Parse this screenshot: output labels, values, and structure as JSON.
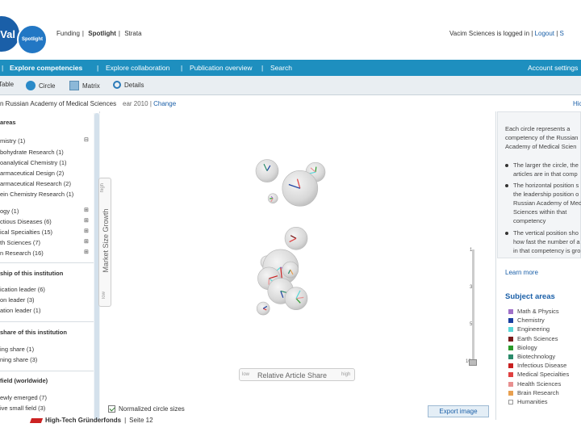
{
  "header": {
    "logo_text": "Val",
    "spotlight_label": "Spotlight",
    "product_nav": [
      "Funding",
      "Spotlight",
      "Strata"
    ],
    "user_text": "Vacim Sciences is logged in",
    "logout_label": "Logout",
    "extra_link": "S"
  },
  "main_nav": {
    "items": [
      "Explore competencies",
      "Explore collaboration",
      "Publication overview",
      "Search"
    ],
    "right_link": "Account settings"
  },
  "view_bar": {
    "items": [
      "Table",
      "Circle",
      "Matrix",
      "Details"
    ]
  },
  "context": {
    "institution": "n Russian Academy of Medical Sciences",
    "year_text": "ear 2010",
    "change_label": "Change",
    "right_label": "Hic"
  },
  "left_panel": {
    "areas_title": "areas",
    "areas_items": [
      "mistry (1)",
      "bohydrate Research (1)",
      "oanalytical Chemistry (1)",
      "armaceutical Design (2)",
      "armaceutical Research (2)",
      "ein Chemistry Research (1)"
    ],
    "areas_items2": [
      "ogy (1)",
      "ctious Diseases (6)",
      "ical Specialties (15)",
      "th Sciences (7)",
      "n Research (16)"
    ],
    "leadership_title": "ship of this institution",
    "leadership_items": [
      "ication leader (6)",
      "on leader (3)",
      "ation leader (1)"
    ],
    "share_title": "share of this institution",
    "share_items": [
      "ing share (1)",
      "ning share (3)"
    ],
    "field_title": "field (worldwide)",
    "field_items": [
      "ewly emerged (7)",
      "ive small field (3)"
    ]
  },
  "chart_axes": {
    "y_label": "Market Size Growth",
    "y_high": "high",
    "y_low": "low",
    "x_label": "Relative Article Share",
    "x_low": "low",
    "x_high": "high",
    "slider_ticks": [
      "1",
      "3",
      "5",
      "10"
    ]
  },
  "chart_data": {
    "type": "scatter",
    "note": "Bubble positions estimated on a 0-100 relative scale",
    "points": [
      {
        "x": 5,
        "y": 88,
        "size": 14
      },
      {
        "x": 30,
        "y": 87,
        "size": 12
      },
      {
        "x": 22,
        "y": 74,
        "size": 22
      },
      {
        "x": 8,
        "y": 66,
        "size": 6
      },
      {
        "x": 20,
        "y": 34,
        "size": 14
      },
      {
        "x": 5,
        "y": 15,
        "size": 8
      },
      {
        "x": 10,
        "y": 16,
        "size": 10
      },
      {
        "x": 12,
        "y": 11,
        "size": 22
      },
      {
        "x": 17,
        "y": 9,
        "size": 10
      },
      {
        "x": 6,
        "y": 2,
        "size": 14
      },
      {
        "x": 12,
        "y": -8,
        "size": 16
      },
      {
        "x": 20,
        "y": -14,
        "size": 14
      },
      {
        "x": 3,
        "y": -22,
        "size": 8
      }
    ]
  },
  "controls": {
    "normalized_label": "Normalized circle sizes",
    "export_label": "Export image"
  },
  "right_panel": {
    "intro_lines": [
      "Each circle represents a",
      "competency of the Russian",
      "Academy of Medical Scien"
    ],
    "bullet1": [
      "The larger the circle, the",
      "articles are in that comp"
    ],
    "bullet2": [
      "The horizontal position s",
      "the leadership position o",
      "Russian Academy of Med",
      "Sciences within that",
      "competency"
    ],
    "bullet3": [
      "The vertical position sho",
      "how fast the number of a",
      "in that competency is gro"
    ],
    "learn_more": "Learn more",
    "subject_title": "Subject areas",
    "subjects": [
      {
        "label": "Math & Physics",
        "color": "#a070c8"
      },
      {
        "label": "Chemistry",
        "color": "#1a3fa0"
      },
      {
        "label": "Engineering",
        "color": "#5ad8d8"
      },
      {
        "label": "Earth Sciences",
        "color": "#7a1a1a"
      },
      {
        "label": "Biology",
        "color": "#2a9a2a"
      },
      {
        "label": "Biotechnology",
        "color": "#2a8a6a"
      },
      {
        "label": "Infectious Disease",
        "color": "#c82020"
      },
      {
        "label": "Medical Specialties",
        "color": "#e04040"
      },
      {
        "label": "Health Sciences",
        "color": "#e89090"
      },
      {
        "label": "Brain Research",
        "color": "#e8a050"
      },
      {
        "label": "Humanities",
        "color": "#ffffff"
      }
    ]
  },
  "footer": {
    "brand": "High-Tech Gründerfonds",
    "page": "Seite 12"
  }
}
